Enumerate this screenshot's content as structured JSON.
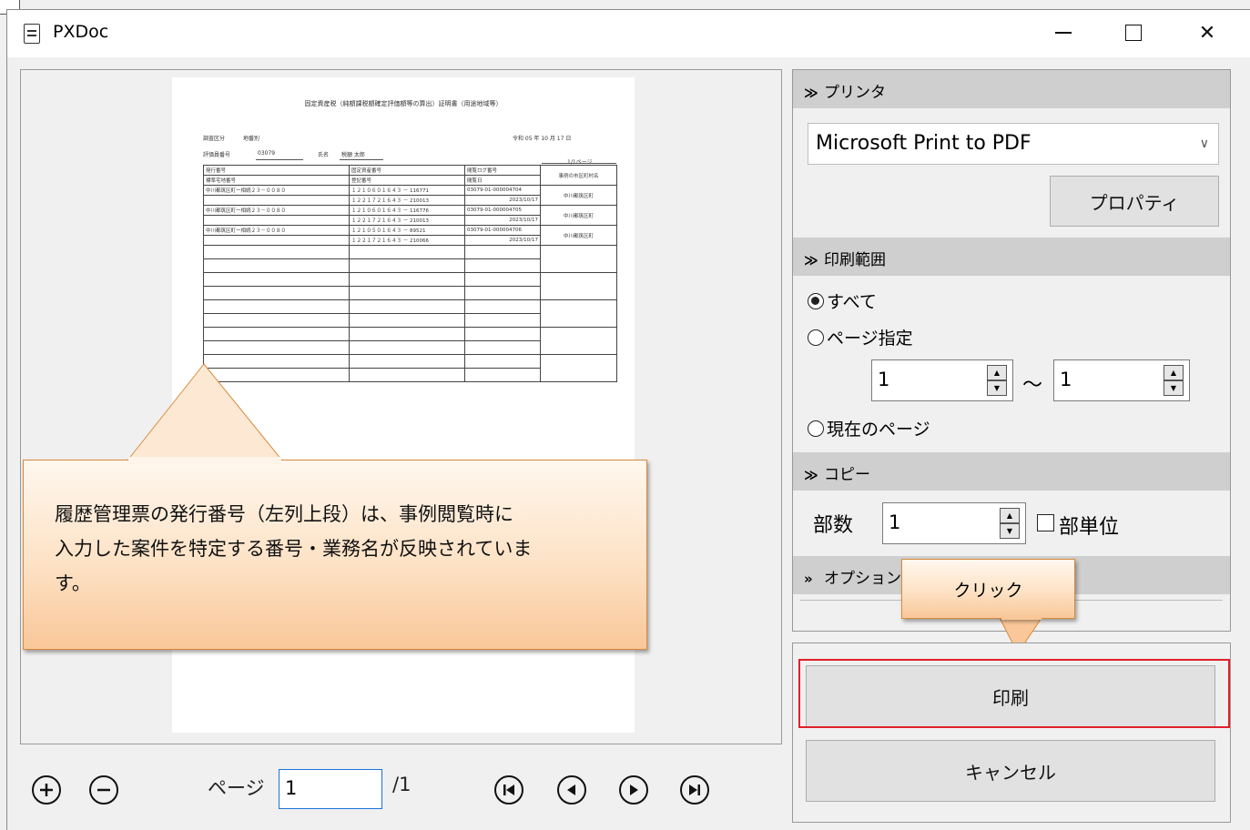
{
  "window": {
    "title": "PXDoc",
    "minimize": "─",
    "close": "✕"
  },
  "document": {
    "title": "固定資産税（純額課税額確定評価額等の算出）証明書（用途地域等）",
    "section_label": "調査区分",
    "section_value": "地番別",
    "date": "令和 05 年 10 月 17 日",
    "eval_label": "評価員番号",
    "eval_value": "03079",
    "name_label": "氏名",
    "name_value": "税額 太郎",
    "page_indicator": "1/1ページ",
    "headers": {
      "col1a": "発行番号",
      "col1b": "標準宅地番号",
      "col2a": "固定資産番号",
      "col2b": "登記番号",
      "col3a": "閲覧ログ番号",
      "col3b": "閲覧日",
      "col4": "事例の市区町村名"
    },
    "rows": [
      {
        "c1a": "中川都筑区町ー相続２３－００８０",
        "c2a": "１２１０６０１６４３ － 116771",
        "c2b": "１２２１７２１６４３ － 210013",
        "c3a": "03079-01-000004704",
        "c3b": "2023/10/17",
        "c4": "中川都筑区町"
      },
      {
        "c1a": "中川都筑区町ー相続２３－００８０",
        "c2a": "１２１０６０１６４３ － 116776",
        "c2b": "１２２１７２１６４３ － 210013",
        "c3a": "03079-01-000004705",
        "c3b": "2023/10/17",
        "c4": "中川都筑区町"
      },
      {
        "c1a": "中川都筑区町ー相続２３－００８０",
        "c2a": "１２１０５０１６４３ － 89521",
        "c2b": "１２２１７２１６４３ － 210066",
        "c3a": "03079-01-000004706",
        "c3b": "2023/10/17",
        "c4": "中川都筑区町"
      }
    ]
  },
  "callout": {
    "line1": "履歴管理票の発行番号（左列上段）は、事例閲覧時に",
    "line2": "入力した案件を特定する番号・業務名が反映されていま",
    "line3": "す。"
  },
  "nav": {
    "page_label": "ページ",
    "page_value": "1",
    "page_total": "/1"
  },
  "sections": {
    "printer": {
      "header": "プリンタ",
      "selected": "Microsoft Print to PDF",
      "properties_button": "プロパティ"
    },
    "range": {
      "header": "印刷範囲",
      "all": "すべて",
      "page_spec": "ページ指定",
      "from": "1",
      "to": "1",
      "tilde": "～",
      "current": "現在のページ"
    },
    "copy": {
      "header": "コピー",
      "copies_label": "部数",
      "copies_value": "1",
      "collate_label": "部単位"
    },
    "options": {
      "header": "オプション"
    }
  },
  "click_callout": "クリック",
  "actions": {
    "print": "印刷",
    "cancel": "キャンセル"
  },
  "colors": {
    "highlight": "#e0202a",
    "callout_border": "#d88a3c",
    "section_header": "#cfcfcf",
    "page_input_border": "#1a74d8"
  }
}
